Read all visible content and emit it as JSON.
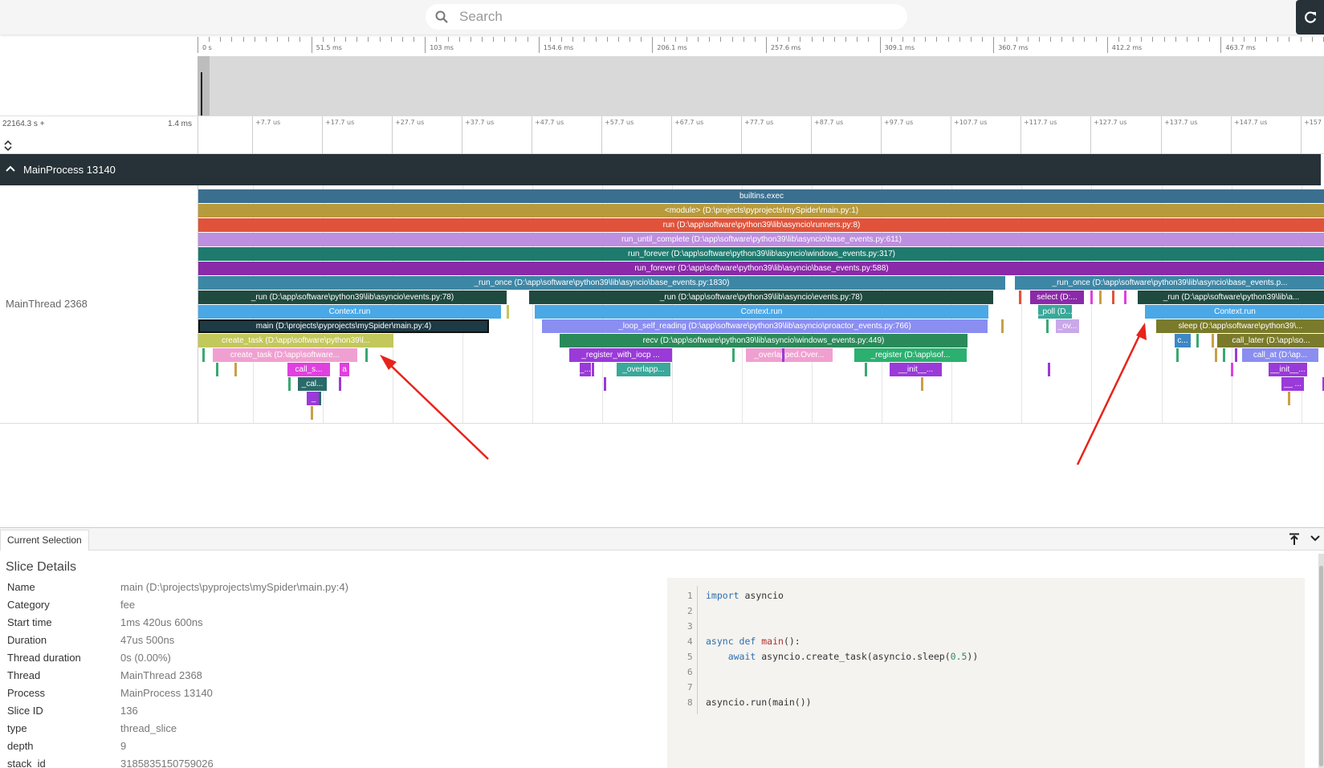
{
  "search": {
    "placeholder": "Search"
  },
  "icons": {
    "search": "search-icon",
    "reload": "reload-icon",
    "collapse": "chevron-up-icon",
    "pin": "pin-top-icon",
    "expand_panel": "chevron-down-icon"
  },
  "overview_ticks": [
    "0 s",
    "51.5 ms",
    "103 ms",
    "154.6 ms",
    "206.1 ms",
    "257.6 ms",
    "309.1 ms",
    "360.7 ms",
    "412.2 ms",
    "463.7 ms"
  ],
  "detail_header": {
    "offset": "22164.3 s +",
    "span": "1.4 ms",
    "ticks": [
      "+7.7 us",
      "+17.7 us",
      "+27.7 us",
      "+37.7 us",
      "+47.7 us",
      "+57.7 us",
      "+67.7 us",
      "+77.7 us",
      "+87.7 us",
      "+97.7 us",
      "+107.7 us",
      "+117.7 us",
      "+127.7 us",
      "+137.7 us",
      "+147.7 us",
      "+157"
    ]
  },
  "process": {
    "name": "MainProcess 13140"
  },
  "thread": {
    "name": "MainThread 2368"
  },
  "slices": [
    "builtins.exec",
    "<module> (D:\\projects\\pyprojects\\mySpider\\main.py:1)",
    "run (D:\\app\\software\\python39\\lib\\asyncio\\runners.py:8)",
    "run_until_complete (D:\\app\\software\\python39\\lib\\asyncio\\base_events.py:611)",
    "run_forever (D:\\app\\software\\python39\\lib\\asyncio\\windows_events.py:317)",
    "run_forever (D:\\app\\software\\python39\\lib\\asyncio\\base_events.py:588)",
    "_run_once (D:\\app\\software\\python39\\lib\\asyncio\\base_events.py:1830)",
    "_run_once (D:\\app\\software\\python39\\lib\\asyncio\\base_events.p...",
    "_run (D:\\app\\software\\python39\\lib\\asyncio\\events.py:78)",
    "_run (D:\\app\\software\\python39\\lib\\asyncio\\events.py:78)",
    "select (D:...",
    "_run (D:\\app\\software\\python39\\lib\\a...",
    "Context.run",
    "Context.run",
    "_poll (D...",
    "Context.run",
    "main (D:\\projects\\pyprojects\\mySpider\\main.py:4)",
    "_loop_self_reading (D:\\app\\software\\python39\\lib\\asyncio\\proactor_events.py:766)",
    "_ov...",
    "sleep (D:\\app\\software\\python39\\...",
    "create_task (D:\\app\\software\\python39\\l...",
    "recv (D:\\app\\software\\python39\\lib\\asyncio\\windows_events.py:449)",
    "c...",
    "call_later (D:\\app\\so...",
    "create_task (D:\\app\\software...",
    "_register_with_iocp ...",
    "_overlapped.Over...",
    "_register (D:\\app\\sof...",
    "call_at (D:\\ap...",
    "call_s...",
    "a",
    "_...",
    "_overlapp...",
    "__init__...",
    "__init__...",
    "_cal...",
    "__l...",
    "_"
  ],
  "panel": {
    "tab": "Current Selection",
    "title": "Slice Details",
    "rows": [
      {
        "label": "Name",
        "value": "main (D:\\projects\\pyprojects\\mySpider\\main.py:4)"
      },
      {
        "label": "Category",
        "value": "fee"
      },
      {
        "label": "Start time",
        "value": "1ms 420us 600ns"
      },
      {
        "label": "Duration",
        "value": "47us 500ns"
      },
      {
        "label": "Thread duration",
        "value": "0s (0.00%)"
      },
      {
        "label": "Thread",
        "value": "MainThread 2368"
      },
      {
        "label": "Process",
        "value": "MainProcess 13140"
      },
      {
        "label": "Slice ID",
        "value": "136"
      },
      {
        "label": "type",
        "value": "thread_slice"
      },
      {
        "label": "depth",
        "value": "9"
      },
      {
        "label": "stack_id",
        "value": "3185835150759026"
      }
    ]
  },
  "code": {
    "line_numbers": [
      "1",
      "2",
      "3",
      "4",
      "5",
      "6",
      "7",
      "8"
    ],
    "l1_kw": "import",
    "l1_rest": " asyncio",
    "l4_kw": "async def ",
    "l4_fn": "main",
    "l4_rest": "():",
    "l5_kw": "    await",
    "l5_rest": " asyncio.create_task(asyncio.sleep(",
    "l5_num": "0.5",
    "l5_end": "))",
    "l8": "asyncio.run(main())"
  },
  "colors": {
    "header_bg": "#263238",
    "selection_border": "#111111",
    "arrow": "#e8231a"
  }
}
